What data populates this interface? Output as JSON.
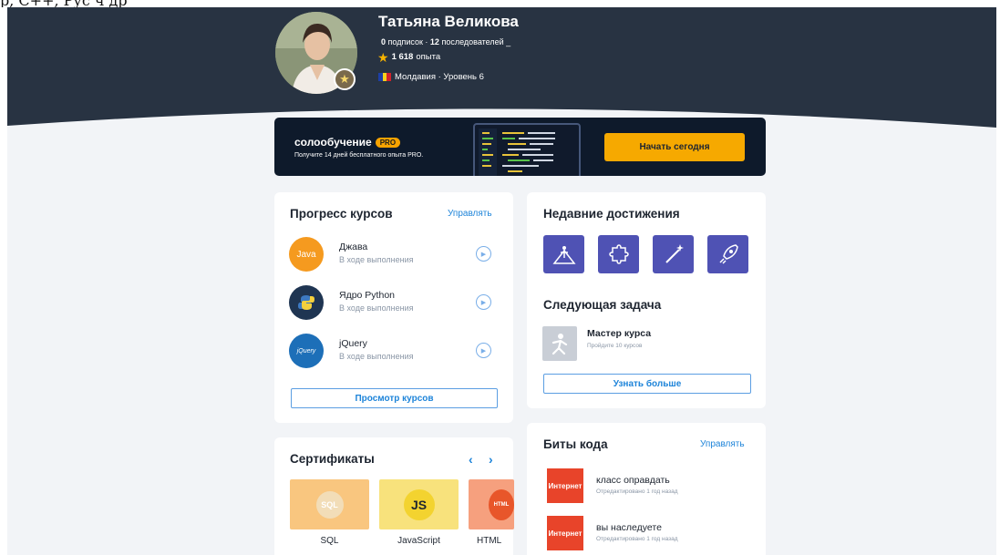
{
  "clipped_text": "р, C++, Рус ч др",
  "profile": {
    "name": "Татьяна Великова",
    "followers_count": "0",
    "followers_label": "подписок",
    "following_count": "12",
    "following_label": "последователей",
    "xp_value": "1 618",
    "xp_label": "опыта",
    "location": "Молдавия · Уровень 6"
  },
  "banner": {
    "brand": "солообучение",
    "pro": "PRO",
    "subtitle": "Получите 14 дней бесплатного опыта PRO.",
    "cta": "Начать сегодня"
  },
  "courses": {
    "title": "Прогресс курсов",
    "manage": "Управлять",
    "items": [
      {
        "icon_text": "Java",
        "name": "Джава",
        "status": "В ходе выполнения",
        "color": "#f59a1f"
      },
      {
        "icon_text": "",
        "name": "Ядро Python",
        "status": "В ходе выполнения",
        "color": "#1f3552"
      },
      {
        "icon_text": "jQuery",
        "name": "jQuery",
        "status": "В ходе выполнения",
        "color": "#1d6fb8"
      }
    ],
    "view_button": "Просмотр курсов"
  },
  "achievements": {
    "title": "Недавние достижения",
    "icons": [
      "trophy-climber-icon",
      "puzzle-icon",
      "magic-wand-icon",
      "rocket-icon"
    ]
  },
  "next_task": {
    "title": "Следующая задача",
    "name": "Мастер курса",
    "description": "Пройдите 10 курсов",
    "button": "Узнать больше"
  },
  "certificates": {
    "title": "Сертификаты",
    "items": [
      {
        "badge": "SQL",
        "label": "SQL",
        "color": "#f9c67f"
      },
      {
        "badge": "JS",
        "label": "JavaScript",
        "color": "#f8e27c"
      },
      {
        "badge": "HTML",
        "label": "HTML",
        "color": "#f6a07e"
      }
    ]
  },
  "code_bits": {
    "title": "Биты кода",
    "manage": "Управлять",
    "items": [
      {
        "thumb": "Интернет",
        "name": "класс оправдать",
        "meta": "Отредактировано 1 год назад"
      },
      {
        "thumb": "Интернет",
        "name": "вы наследуете",
        "meta": "Отредактировано 1 год назад"
      }
    ]
  },
  "colors": {
    "header_bg": "#283342",
    "accent_orange": "#f6a900",
    "link_blue": "#1e84d9",
    "achievement_bg": "#4f52b4",
    "code_bit_red": "#e8442a"
  }
}
